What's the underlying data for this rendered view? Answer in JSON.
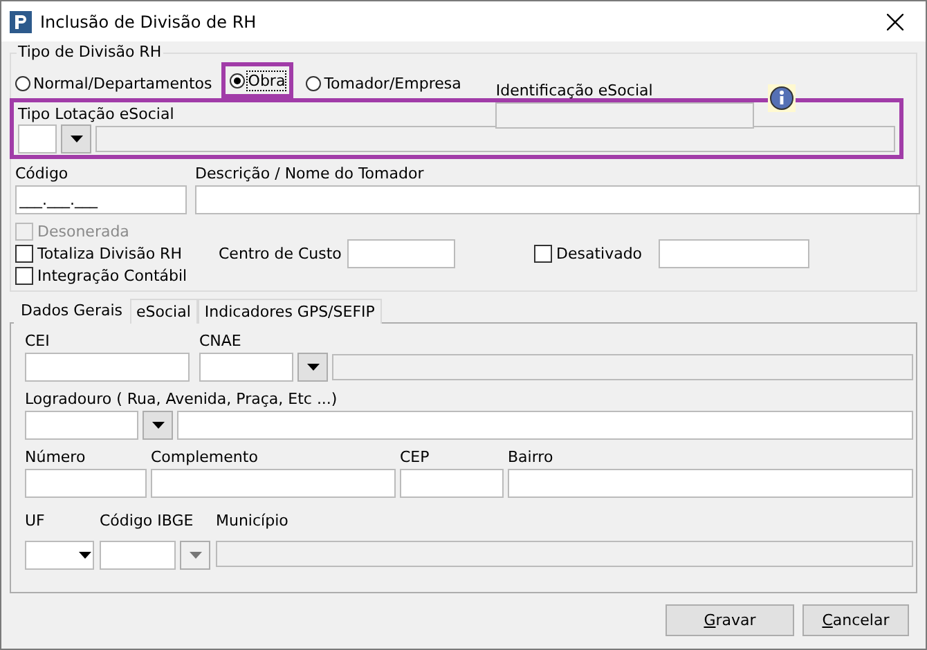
{
  "window": {
    "title": "Inclusão de Divisão de RH"
  },
  "tipo_divisao": {
    "title": "Tipo de Divisão RH",
    "radios": [
      {
        "label": "Normal/Departamentos",
        "selected": false,
        "highlighted": false
      },
      {
        "label": "Obra",
        "selected": true,
        "highlighted": true
      },
      {
        "label": "Tomador/Empresa",
        "selected": false,
        "highlighted": false
      }
    ],
    "identificacao": {
      "label": "Identificação eSocial"
    },
    "lotacao": {
      "label": "Tipo Lotação eSocial",
      "highlighted": true
    }
  },
  "codigo": {
    "label": "Código",
    "value": "___.___.___"
  },
  "descricao": {
    "label": "Descrição / Nome do Tomador"
  },
  "checks": [
    {
      "label": "Desonerada",
      "checked": false,
      "disabled": true
    },
    {
      "label": "Totaliza Divisão RH",
      "checked": false,
      "disabled": false
    },
    {
      "label": "Integração Contábil",
      "checked": false,
      "disabled": false
    }
  ],
  "centro_custo": {
    "label": "Centro de Custo"
  },
  "desativado": {
    "label": "Desativado",
    "checked": false
  },
  "tabs": [
    {
      "label": "Dados Gerais",
      "selected": true
    },
    {
      "label": "eSocial",
      "selected": false
    },
    {
      "label": "Indicadores GPS/SEFIP",
      "selected": false
    }
  ],
  "panel": {
    "cei": "CEI",
    "cnae": "CNAE",
    "logradouro": "Logradouro ( Rua, Avenida, Praça, Etc ...)",
    "numero": "Número",
    "complemento": "Complemento",
    "cep": "CEP",
    "bairro": "Bairro",
    "uf": "UF",
    "ibge": "Código IBGE",
    "municipio": "Município"
  },
  "buttons": [
    {
      "label": "Gravar"
    },
    {
      "label": "Cancelar"
    }
  ]
}
